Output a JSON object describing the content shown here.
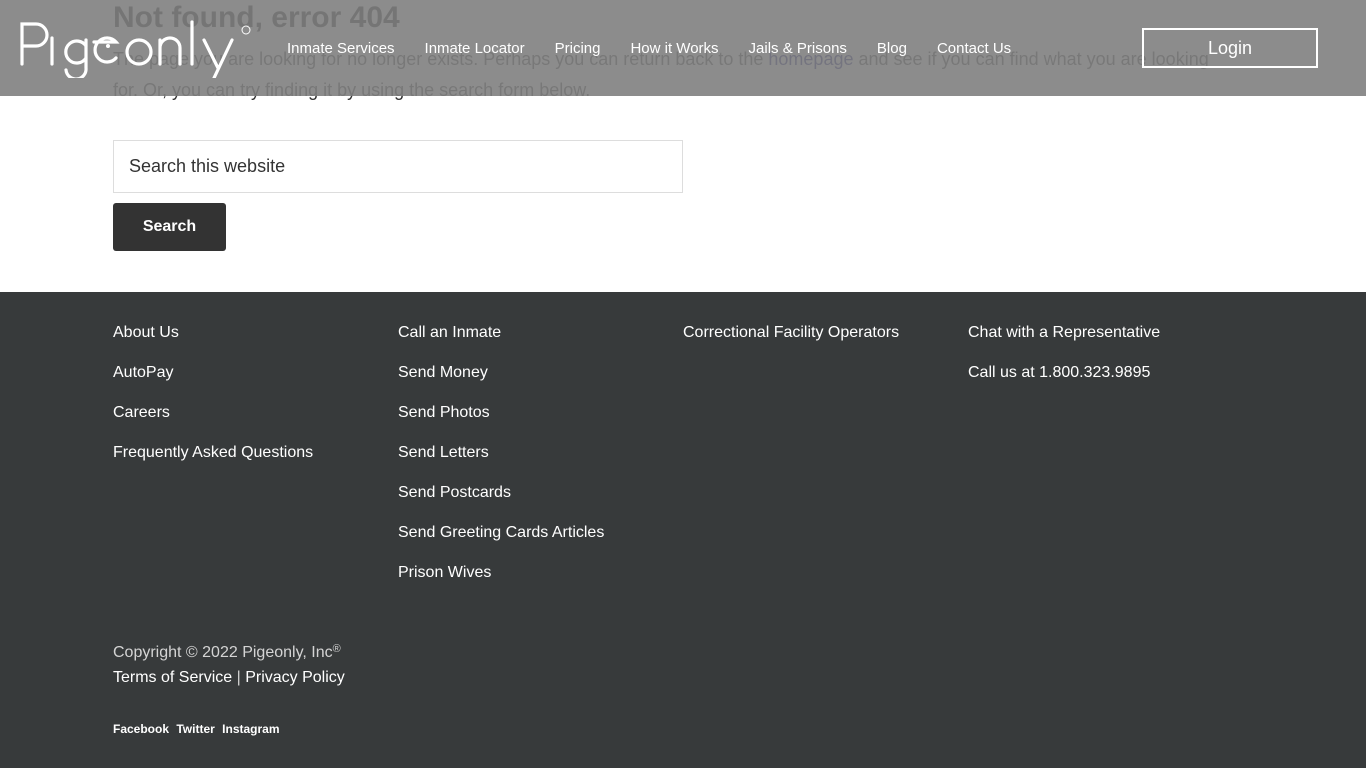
{
  "header": {
    "logo_text": "Pigeonly",
    "nav": [
      {
        "label": "Inmate Services"
      },
      {
        "label": "Inmate Locator"
      },
      {
        "label": "Pricing"
      },
      {
        "label": "How it Works"
      },
      {
        "label": "Jails & Prisons"
      },
      {
        "label": "Blog"
      },
      {
        "label": "Contact Us"
      }
    ],
    "login_label": "Login"
  },
  "main": {
    "title": "Not found, error 404",
    "desc_before": "The page you are looking for no longer exists. Perhaps you can return back to the ",
    "desc_link": "homepage",
    "desc_after": " and see if you can find what you are looking for. Or, you can try finding it by using the search form below.",
    "search_placeholder": "Search this website",
    "search_value": "",
    "search_button": "Search"
  },
  "footer": {
    "col1": [
      "About Us",
      "AutoPay",
      "Careers",
      "Frequently Asked Questions"
    ],
    "col2": [
      "Call an Inmate",
      "Send Money",
      "Send Photos",
      "Send Letters",
      "Send Postcards",
      "Send Greeting Cards Articles",
      "Prison Wives"
    ],
    "col3": [
      "Correctional Facility Operators"
    ],
    "col4": [
      "Chat with a Representative",
      "Call us at 1.800.323.9895"
    ],
    "copyright": "Copyright © 2022 Pigeonly, Inc",
    "registered": "®",
    "terms": "Terms of Service",
    "separator": " | ",
    "privacy": "Privacy Policy",
    "social": [
      "Facebook",
      "Twitter",
      "Instagram"
    ]
  },
  "colors": {
    "header_bg": "#808080",
    "footer_bg": "#373a3b",
    "button_bg": "#333333",
    "link": "#0c0a7a"
  }
}
